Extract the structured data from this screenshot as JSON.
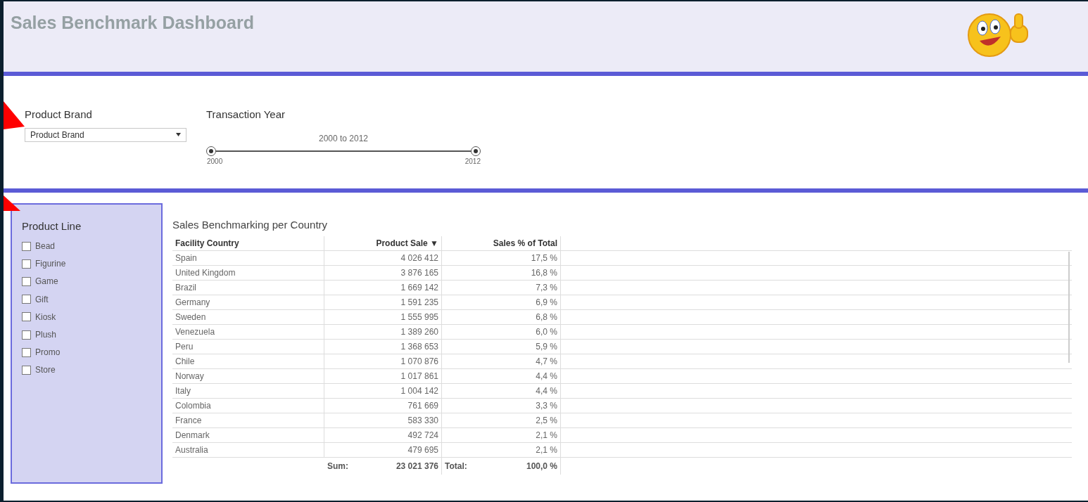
{
  "header": {
    "title": "Sales Benchmark Dashboard"
  },
  "filters": {
    "brand": {
      "label": "Product Brand",
      "value": "Product Brand"
    },
    "year": {
      "label": "Transaction Year",
      "range_text": "2000 to 2012",
      "min_label": "2000",
      "max_label": "2012",
      "level": 1
    }
  },
  "product_line": {
    "title": "Product Line",
    "items": [
      {
        "label": "Bead",
        "checked": false
      },
      {
        "label": "Figurine",
        "checked": false
      },
      {
        "label": "Game",
        "checked": false
      },
      {
        "label": "Gift",
        "checked": false
      },
      {
        "label": "Kiosk",
        "checked": false
      },
      {
        "label": "Plush",
        "checked": false
      },
      {
        "label": "Promo",
        "checked": false
      },
      {
        "label": "Store",
        "checked": false
      }
    ]
  },
  "table": {
    "title": "Sales Benchmarking per Country",
    "columns": [
      {
        "label": "Facility Country"
      },
      {
        "label": "Product Sale",
        "sort_mark": "▼"
      },
      {
        "label": "Sales % of Total"
      }
    ],
    "rows": [
      [
        "Spain",
        "4 026 412",
        "17,5 %"
      ],
      [
        "United Kingdom",
        "3 876 165",
        "16,8 %"
      ],
      [
        "Brazil",
        "1 669 142",
        "7,3 %"
      ],
      [
        "Germany",
        "1 591 235",
        "6,9 %"
      ],
      [
        "Sweden",
        "1 555 995",
        "6,8 %"
      ],
      [
        "Venezuela",
        "1 389 260",
        "6,0 %"
      ],
      [
        "Peru",
        "1 368 653",
        "5,9 %"
      ],
      [
        "Chile",
        "1 070 876",
        "4,7 %"
      ],
      [
        "Norway",
        "1 017 861",
        "4,4 %"
      ],
      [
        "Italy",
        "1 004 142",
        "4,4 %"
      ],
      [
        "Colombia",
        "761 669",
        "3,3 %"
      ],
      [
        "France",
        "583 330",
        "2,5 %"
      ],
      [
        "Denmark",
        "492 724",
        "2,1 %"
      ],
      [
        "Australia",
        "479 695",
        "2,1 %"
      ]
    ],
    "totals": {
      "sum_label": "Sum:",
      "sum": "23 021 376",
      "total_label": "Total:",
      "total": "100,0 %"
    }
  }
}
